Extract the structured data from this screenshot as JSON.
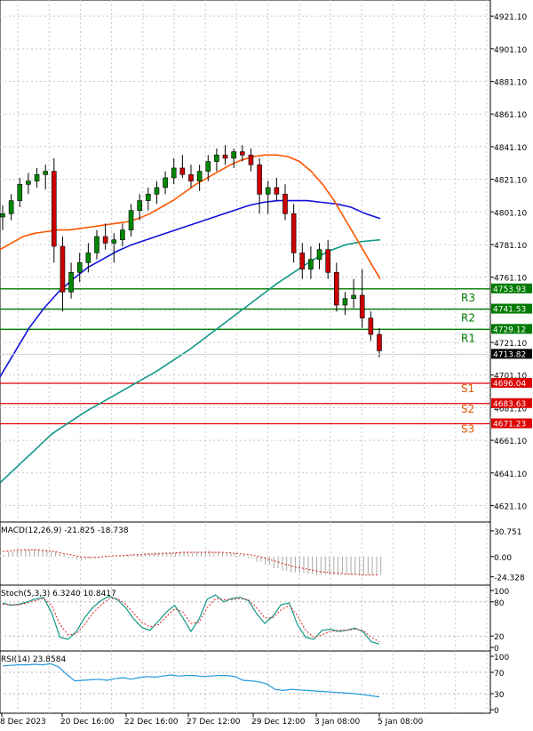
{
  "chart_data": [
    {
      "type": "candlestick",
      "price_axis": {
        "ticks": [
          "4921.10",
          "4901.10",
          "4881.10",
          "4861.10",
          "4841.10",
          "4821.10",
          "4801.10",
          "4781.10",
          "4761.10",
          "4741.10",
          "4721.10",
          "4701.10",
          "4681.10",
          "4661.10",
          "4641.10",
          "4621.10"
        ],
        "ylim": [
          4611,
          4931
        ]
      },
      "time_axis": {
        "labels": [
          "8 Dec 2023",
          "20 Dec 16:00",
          "22 Dec 16:00",
          "27 Dec 12:00",
          "29 Dec 12:00",
          "3 Jan 08:00",
          "5 Jan 08:00"
        ]
      },
      "current_price": "4713.82",
      "levels": [
        {
          "name": "R3",
          "value": 4753.93,
          "label": "4753.93",
          "color": "#007a00"
        },
        {
          "name": "R2",
          "value": 4741.53,
          "label": "4741.53",
          "color": "#007a00"
        },
        {
          "name": "R1",
          "value": 4729.12,
          "label": "4729.12",
          "color": "#007a00"
        },
        {
          "name": "S1",
          "value": 4696.04,
          "label": "4696.04",
          "color": "#dd0000"
        },
        {
          "name": "S2",
          "value": 4683.63,
          "label": "4683.63",
          "color": "#dd0000"
        },
        {
          "name": "S3",
          "value": 4671.23,
          "label": "4671.23",
          "color": "#dd0000"
        }
      ],
      "colors": {
        "up": "#008800",
        "down": "#cc0000",
        "ma_fast": "#ff5500",
        "ma_mid": "#1010dd",
        "ma_slow": "#119988",
        "grid": "#c8c8c8"
      },
      "candles": [
        [
          4798,
          4805,
          4790,
          4800
        ],
        [
          4800,
          4812,
          4796,
          4808
        ],
        [
          4808,
          4822,
          4804,
          4818
        ],
        [
          4818,
          4825,
          4812,
          4820
        ],
        [
          4820,
          4828,
          4816,
          4824
        ],
        [
          4824,
          4830,
          4815,
          4826
        ],
        [
          4826,
          4834,
          4770,
          4780
        ],
        [
          4780,
          4786,
          4740,
          4752
        ],
        [
          4752,
          4770,
          4748,
          4764
        ],
        [
          4764,
          4776,
          4758,
          4770
        ],
        [
          4770,
          4782,
          4764,
          4776
        ],
        [
          4776,
          4790,
          4772,
          4786
        ],
        [
          4786,
          4794,
          4778,
          4782
        ],
        [
          4782,
          4788,
          4770,
          4784
        ],
        [
          4784,
          4794,
          4780,
          4790
        ],
        [
          4790,
          4806,
          4786,
          4802
        ],
        [
          4802,
          4812,
          4796,
          4808
        ],
        [
          4808,
          4816,
          4802,
          4812
        ],
        [
          4812,
          4820,
          4806,
          4816
        ],
        [
          4816,
          4826,
          4812,
          4822
        ],
        [
          4822,
          4834,
          4818,
          4828
        ],
        [
          4828,
          4836,
          4822,
          4824
        ],
        [
          4824,
          4830,
          4816,
          4820
        ],
        [
          4820,
          4830,
          4814,
          4826
        ],
        [
          4826,
          4836,
          4820,
          4832
        ],
        [
          4832,
          4840,
          4826,
          4836
        ],
        [
          4836,
          4842,
          4830,
          4834
        ],
        [
          4834,
          4840,
          4828,
          4838
        ],
        [
          4838,
          4842,
          4832,
          4836
        ],
        [
          4836,
          4840,
          4826,
          4830
        ],
        [
          4830,
          4834,
          4800,
          4812
        ],
        [
          4812,
          4820,
          4800,
          4816
        ],
        [
          4816,
          4822,
          4808,
          4812
        ],
        [
          4812,
          4818,
          4796,
          4800
        ],
        [
          4800,
          4806,
          4770,
          4776
        ],
        [
          4776,
          4782,
          4760,
          4766
        ],
        [
          4766,
          4780,
          4760,
          4772
        ],
        [
          4772,
          4782,
          4766,
          4778
        ],
        [
          4778,
          4784,
          4760,
          4764
        ],
        [
          4764,
          4770,
          4740,
          4744
        ],
        [
          4744,
          4752,
          4738,
          4748
        ],
        [
          4748,
          4760,
          4742,
          4750
        ],
        [
          4750,
          4766,
          4730,
          4736
        ],
        [
          4736,
          4740,
          4722,
          4726
        ],
        [
          4726,
          4730,
          4712,
          4716
        ]
      ],
      "ma_fast": [
        4778,
        4782,
        4786,
        4788,
        4789,
        4790,
        4790,
        4791,
        4792,
        4793,
        4794,
        4795,
        4797,
        4800,
        4804,
        4808,
        4813,
        4818,
        4822,
        4826,
        4830,
        4833,
        4835,
        4836,
        4836,
        4835,
        4832,
        4826,
        4818,
        4808,
        4796,
        4784,
        4772,
        4760
      ],
      "ma_mid": [
        4700,
        4715,
        4730,
        4742,
        4752,
        4760,
        4767,
        4772,
        4777,
        4781,
        4784,
        4787,
        4790,
        4793,
        4796,
        4799,
        4802,
        4805,
        4807,
        4808,
        4808,
        4808,
        4807,
        4806,
        4804,
        4800,
        4797
      ],
      "ma_slow": [
        4635,
        4645,
        4655,
        4665,
        4672,
        4679,
        4685,
        4691,
        4697,
        4703,
        4710,
        4717,
        4725,
        4733,
        4741,
        4749,
        4757,
        4764,
        4771,
        4777,
        4781,
        4783,
        4784
      ]
    },
    {
      "type": "histogram",
      "title": "MACD(12,26,9) -21.825 -18.738",
      "ticks": [
        "30.751",
        "0.00",
        "-24.328"
      ],
      "ylim": [
        -30,
        36
      ]
    },
    {
      "type": "line",
      "title": "Stoch(5,3,3) 6.3240 10.8417",
      "ticks": [
        "100",
        "80",
        "20",
        "0"
      ],
      "ylim": [
        0,
        100
      ]
    },
    {
      "type": "line",
      "title": "RSI(14) 23.8584",
      "ticks": [
        "100",
        "70",
        "30",
        "0"
      ],
      "ylim": [
        0,
        100
      ]
    }
  ]
}
